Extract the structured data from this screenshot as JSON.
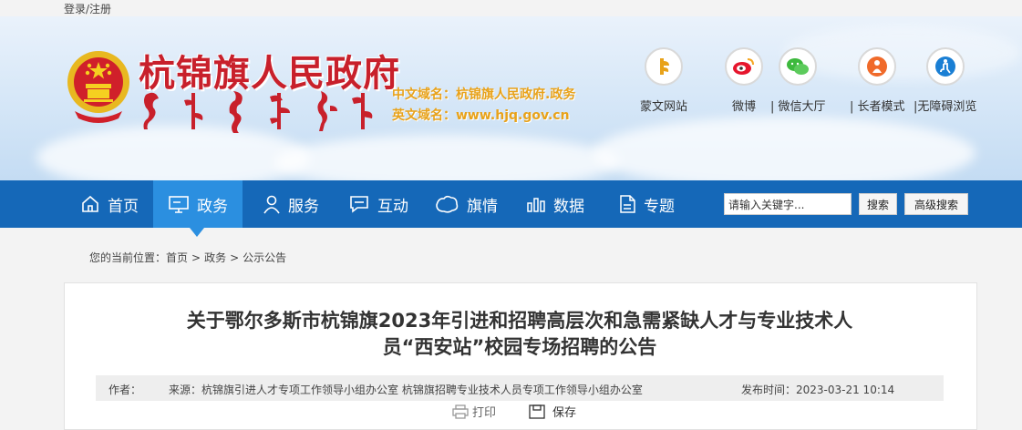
{
  "topbar": {
    "login": "登录/注册"
  },
  "header": {
    "site_title": "杭锦旗人民政府",
    "cn_domain_label": "中文域名：",
    "cn_domain": "杭锦旗人民政府.政务",
    "en_domain_label": "英文域名：",
    "en_domain": "www.hjq.gov.cn"
  },
  "tools": [
    {
      "label": "蒙文网站",
      "icon": "mongolian-script-icon"
    },
    {
      "label": "微博",
      "icon": "weibo-icon"
    },
    {
      "label": "| 微信大厅",
      "icon": "wechat-icon"
    },
    {
      "label": "| 长者模式",
      "icon": "elder-mode-icon"
    },
    {
      "label": "|无障碍浏览",
      "icon": "accessibility-icon"
    }
  ],
  "nav": [
    {
      "label": "首页",
      "icon": "home-icon"
    },
    {
      "label": "政务",
      "icon": "monitor-icon",
      "active": true
    },
    {
      "label": "服务",
      "icon": "person-icon"
    },
    {
      "label": "互动",
      "icon": "chat-icon"
    },
    {
      "label": "旗情",
      "icon": "map-icon"
    },
    {
      "label": "数据",
      "icon": "data-icon"
    },
    {
      "label": "专题",
      "icon": "document-icon"
    }
  ],
  "search": {
    "placeholder": "请输入关键字...",
    "button": "搜索",
    "advanced": "高级搜索"
  },
  "breadcrumb": {
    "prefix": "您的当前位置：",
    "items": [
      "首页",
      "政务",
      "公示公告"
    ],
    "sep": ">"
  },
  "article": {
    "title_line1": "关于鄂尔多斯市杭锦旗2023年引进和招聘高层次和急需紧缺人才与专业技术人",
    "title_line2": "员“西安站”校园专场招聘的公告",
    "author_label": "作者：",
    "source": "来源：杭锦旗引进人才专项工作领导小组办公室 杭锦旗招聘专业技术人员专项工作领导小组办公室",
    "time": "发布时间：2023-03-21 10:14",
    "print": "打印",
    "save": "保存"
  },
  "colors": {
    "nav_bg": "#1568b8",
    "nav_active": "#2b8fe0",
    "title_red": "#c8202b",
    "domain_orange": "#e8a21a"
  }
}
